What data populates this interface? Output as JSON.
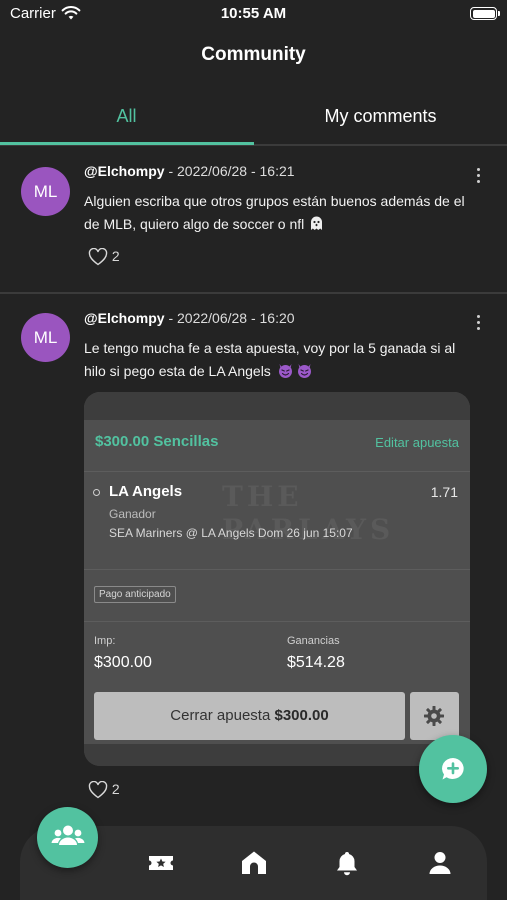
{
  "status_bar": {
    "carrier": "Carrier",
    "time": "10:55 AM"
  },
  "page_title": "Community",
  "tabs": [
    {
      "label": "All",
      "active": true
    },
    {
      "label": "My comments",
      "active": false
    }
  ],
  "posts": [
    {
      "avatar_initials": "ML",
      "handle": "@Elchompy",
      "timestamp": " - 2022/06/28 - 16:21",
      "text": "Alguien escriba que otros grupos están buenos además de el de MLB, quiero algo de soccer o nfl",
      "emoji": "ghost",
      "likes": "2"
    },
    {
      "avatar_initials": "ML",
      "handle": "@Elchompy",
      "timestamp": " - 2022/06/28 - 16:20",
      "text": "Le tengo mucha fe a esta apuesta, voy por la 5 ganada si al hilo si pego esta de LA Angels",
      "emoji": "smiling-devil x2",
      "likes": "2",
      "bet": {
        "amount_label": "$300.00  Sencillas",
        "edit_label": "Editar apuesta",
        "team": "LA Angels",
        "odds": "1.71",
        "market": "Ganador",
        "event": "SEA Mariners @ LA Angels   Dom 26 jun 15:07",
        "pago_label": "Pago anticipado",
        "stake_label": "Imp:",
        "stake_value": "$300.00",
        "winnings_label": "Ganancias",
        "winnings_value": "$514.28",
        "place_button_prefix": "Cerrar apuesta ",
        "place_button_amount": "$300.00"
      }
    }
  ],
  "colors": {
    "accent": "#52c2a0",
    "background": "#232323",
    "avatar": "#9a55bf"
  },
  "nav": {
    "items": [
      "community-icon",
      "ticket-star-icon",
      "home-icon",
      "bell-icon",
      "profile-icon"
    ],
    "active": "community-icon"
  }
}
